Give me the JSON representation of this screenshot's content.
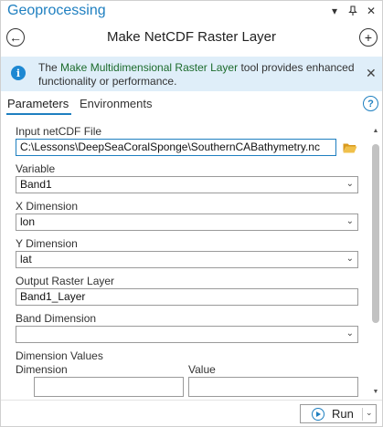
{
  "window": {
    "title": "Geoprocessing",
    "chevron_icon": "▾",
    "pin_icon": "⊓",
    "close_icon": "✕"
  },
  "toolhead": {
    "back_icon": "←",
    "tool_title": "Make NetCDF Raster Layer",
    "add_icon": "+"
  },
  "info": {
    "icon": "i",
    "text_before": "The ",
    "link": "Make Multidimensional Raster Layer",
    "text_after": " tool provides enhanced functionality or performance.",
    "close_icon": "✕"
  },
  "tabs": {
    "parameters": "Parameters",
    "environments": "Environments",
    "help_icon": "?"
  },
  "params": {
    "input_label": "Input netCDF File",
    "input_value": "C:\\Lessons\\DeepSeaCoralSponge\\SouthernCABathymetry.nc",
    "variable_label": "Variable",
    "variable_value": "Band1",
    "x_label": "X Dimension",
    "x_value": "lon",
    "y_label": "Y Dimension",
    "y_value": "lat",
    "output_label": "Output Raster Layer",
    "output_value": "Band1_Layer",
    "band_label": "Band Dimension",
    "band_value": "",
    "dimvals_label": "Dimension Values",
    "dim_col": "Dimension",
    "value_col": "Value"
  },
  "dropdown_chevron": "⌄",
  "footer": {
    "run_label": "Run",
    "run_chevron": "⌄"
  },
  "colors": {
    "accent": "#1e7fc0",
    "info_bg": "#dfeef9",
    "link_green": "#1c6b2c",
    "folder": "#e8b33a"
  }
}
